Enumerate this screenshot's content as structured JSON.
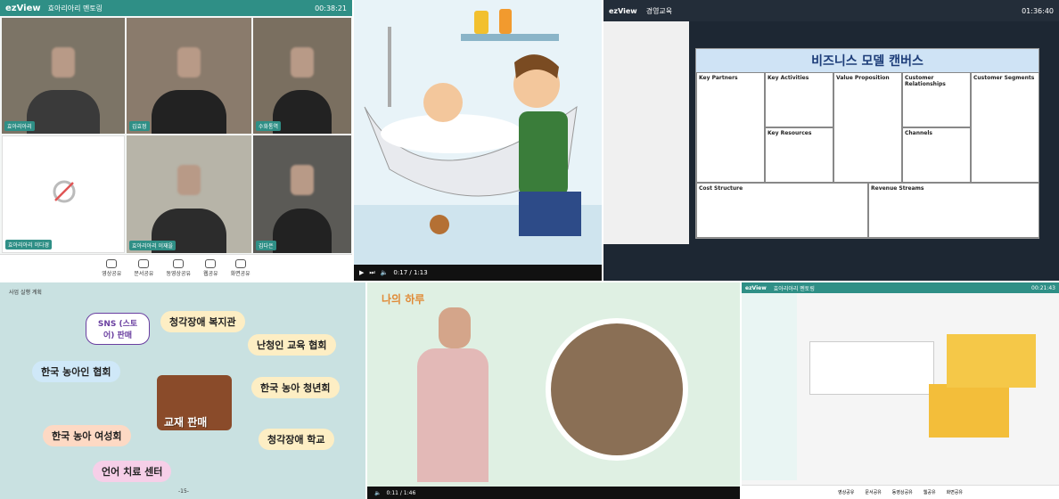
{
  "p1": {
    "app": "ezView",
    "title": "효아리아리 멘토링",
    "time": "00:38:21",
    "tags": [
      "효아리아리",
      "김효정",
      "수화통역",
      "효아리아리 이다경",
      "효아리아리 이재을",
      "김다은"
    ],
    "tools": [
      "영상공유",
      "문서공유",
      "동영상공유",
      "웹공유",
      "화면공유"
    ]
  },
  "p2": {
    "time": "0:17 / 1:13"
  },
  "p3": {
    "app": "ezView",
    "title": "경영교육",
    "time": "01:36:40",
    "canvas_title": "비즈니스 모델 캔버스",
    "cells": [
      {
        "h": "Key Partners"
      },
      {
        "h": "Key Activities"
      },
      {
        "h": "Key Resources"
      },
      {
        "h": "Value Proposition"
      },
      {
        "h": "Customer Relationships"
      },
      {
        "h": "Channels"
      },
      {
        "h": "Customer Segments"
      },
      {
        "h": "Cost Structure"
      },
      {
        "h": "Revenue Streams"
      }
    ]
  },
  "p4": {
    "header": "사업 실행 계획",
    "center": "교재 판매",
    "page": "-15-",
    "items": [
      "SNS (스토어) 판매",
      "청각장애 복지관",
      "난청인 교육 협회",
      "한국 농아인 협회",
      "한국 농아 청년회",
      "한국 농아 여성회",
      "청각장애 학교",
      "언어 치료 센터"
    ]
  },
  "p5": {
    "title": "나의 하루",
    "time": "0:11 / 1:46"
  },
  "p6": {
    "app": "ezView",
    "title": "효아리아리 멘토링",
    "time": "00:21:43",
    "tools": [
      "영상공유",
      "문서공유",
      "동영상공유",
      "웹공유",
      "화면공유"
    ]
  }
}
